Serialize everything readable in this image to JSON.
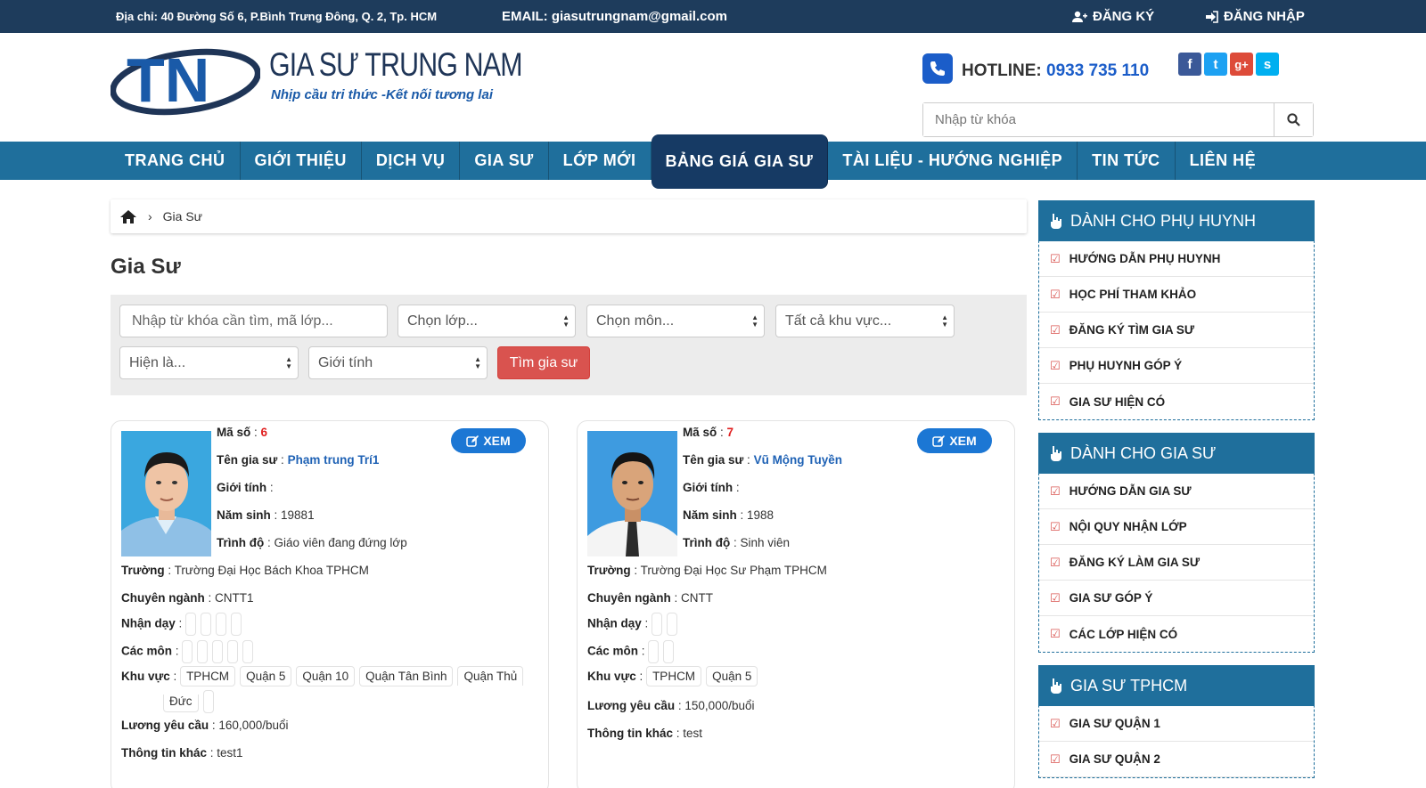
{
  "topbar": {
    "address": "Địa chỉ: 40 Đường Số 6, P.Bình Trưng Đông, Q. 2, Tp. HCM",
    "email": "EMAIL: giasutrungnam@gmail.com",
    "register": "ĐĂNG KÝ",
    "login": "ĐĂNG NHẬP"
  },
  "header": {
    "logo_mark": "TN",
    "brand": "GIA SƯ TRUNG NAM",
    "slogan": "Nhịp cầu tri thức -Kết nối tương lai",
    "hotline_label": "HOTLINE:",
    "hotline_number": "0933 735 110",
    "social": [
      "f",
      "t",
      "g+",
      "s"
    ],
    "search_placeholder": "Nhập từ khóa"
  },
  "nav": {
    "items": [
      "TRANG CHỦ",
      "GIỚI THIỆU",
      "DỊCH VỤ",
      "GIA SƯ",
      "LỚP MỚI",
      "BẢNG GIÁ GIA SƯ",
      "TÀI LIỆU - HƯỚNG NGHIỆP",
      "TIN TỨC",
      "LIÊN HỆ"
    ],
    "active": "BẢNG GIÁ GIA SƯ"
  },
  "breadcrumb": {
    "current": "Gia Sư"
  },
  "page_title": "Gia Sư",
  "filter": {
    "keyword_placeholder": "Nhập từ khóa cần tìm, mã lớp...",
    "class_select": "Chọn lớp...",
    "subject_select": "Chọn môn...",
    "area_select": "Tất cả khu vực...",
    "current_select": "Hiện là...",
    "gender_select": "Giới tính",
    "search_button": "Tìm gia sư"
  },
  "labels": {
    "code": "Mã số",
    "name": "Tên gia sư",
    "gender": "Giới tính",
    "birth": "Năm sinh",
    "level": "Trình độ",
    "school": "Trường",
    "major": "Chuyên ngành",
    "teach": "Nhận dạy",
    "subjects": "Các môn",
    "area": "Khu vực",
    "salary": "Lương yêu cầu",
    "other": "Thông tin khác",
    "view": "XEM"
  },
  "tutors": [
    {
      "code": "6",
      "name": "Phạm trung Trí1",
      "gender": "",
      "birth": "19881",
      "level": "Giáo viên đang đứng lớp",
      "school": "Trường Đại Học Bách Khoa TPHCM",
      "major": "CNTT1",
      "areas": [
        "TPHCM",
        "Quận 5",
        "Quận 10",
        "Quận Tân Bình",
        "Quận Thủ",
        "Đức"
      ],
      "salary": "160,000/buổi",
      "other": "test1"
    },
    {
      "code": "7",
      "name": "Vũ Mộng Tuyền",
      "gender": "",
      "birth": "1988",
      "level": "Sinh viên",
      "school": "Trường Đại Học Sư Phạm TPHCM",
      "major": "CNTT",
      "areas": [
        "TPHCM",
        "Quận 5"
      ],
      "salary": "150,000/buổi",
      "other": "test"
    }
  ],
  "sidebar": {
    "parents": {
      "title": "DÀNH CHO PHỤ HUYNH",
      "items": [
        "HƯỚNG DẪN PHỤ HUYNH",
        "HỌC PHÍ THAM KHẢO",
        "ĐĂNG KÝ TÌM GIA SƯ",
        "PHỤ HUYNH GÓP Ý",
        "GIA SƯ HIỆN CÓ"
      ]
    },
    "tutors": {
      "title": "DÀNH CHO GIA SƯ",
      "items": [
        "HƯỚNG DẪN GIA SƯ",
        "NỘI QUY NHẬN LỚP",
        "ĐĂNG KÝ LÀM GIA SƯ",
        "GIA SƯ GÓP Ý",
        "CÁC LỚP HIỆN CÓ"
      ]
    },
    "hcm": {
      "title": "GIA SƯ TPHCM",
      "items": [
        "GIA SƯ QUẬN 1",
        "GIA SƯ QUẬN 2"
      ]
    }
  }
}
